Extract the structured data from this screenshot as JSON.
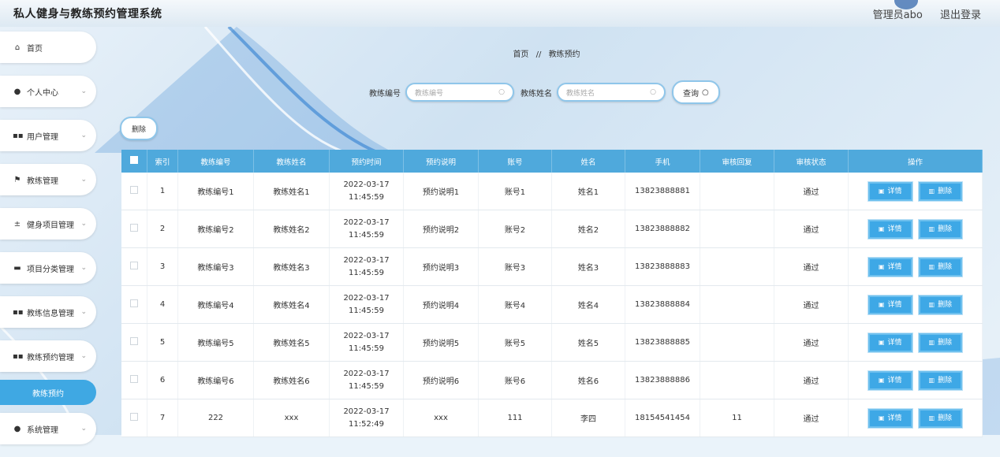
{
  "app": {
    "title": "私人健身与教练预约管理系统"
  },
  "header": {
    "user": "管理员abo",
    "logout": "退出登录"
  },
  "sidebar": {
    "items": [
      {
        "label": "首页",
        "icon": "home-icon"
      },
      {
        "label": "个人中心",
        "icon": "user-icon"
      },
      {
        "label": "用户管理",
        "icon": "grid-icon"
      },
      {
        "label": "教练管理",
        "icon": "flag-icon"
      },
      {
        "label": "健身项目管理",
        "icon": "dumbbell-icon"
      },
      {
        "label": "项目分类管理",
        "icon": "bookmark-icon"
      },
      {
        "label": "教练信息管理",
        "icon": "grid-icon"
      },
      {
        "label": "教练预约管理",
        "icon": "grid-icon"
      },
      {
        "label": "系统管理",
        "icon": "user-icon"
      }
    ],
    "active_sub": "教练预约"
  },
  "breadcrumb": {
    "home": "首页",
    "sep": "//",
    "current": "教练预约"
  },
  "search": {
    "field1_label": "教练编号",
    "field1_placeholder": "教练编号",
    "field2_label": "教练姓名",
    "field2_placeholder": "教练姓名",
    "query_label": "查询"
  },
  "actions": {
    "delete_label": "删除"
  },
  "table": {
    "headers": [
      "索引",
      "教练编号",
      "教练姓名",
      "预约时间",
      "预约说明",
      "账号",
      "姓名",
      "手机",
      "审核回复",
      "审核状态",
      "操作"
    ],
    "rows": [
      {
        "idx": "1",
        "coach_no": "教练编号1",
        "coach_name": "教练姓名1",
        "time": "2022-03-17 11:45:59",
        "note": "预约说明1",
        "account": "账号1",
        "name": "姓名1",
        "phone": "13823888881",
        "reply": "",
        "status": "通过"
      },
      {
        "idx": "2",
        "coach_no": "教练编号2",
        "coach_name": "教练姓名2",
        "time": "2022-03-17 11:45:59",
        "note": "预约说明2",
        "account": "账号2",
        "name": "姓名2",
        "phone": "13823888882",
        "reply": "",
        "status": "通过"
      },
      {
        "idx": "3",
        "coach_no": "教练编号3",
        "coach_name": "教练姓名3",
        "time": "2022-03-17 11:45:59",
        "note": "预约说明3",
        "account": "账号3",
        "name": "姓名3",
        "phone": "13823888883",
        "reply": "",
        "status": "通过"
      },
      {
        "idx": "4",
        "coach_no": "教练编号4",
        "coach_name": "教练姓名4",
        "time": "2022-03-17 11:45:59",
        "note": "预约说明4",
        "account": "账号4",
        "name": "姓名4",
        "phone": "13823888884",
        "reply": "",
        "status": "通过"
      },
      {
        "idx": "5",
        "coach_no": "教练编号5",
        "coach_name": "教练姓名5",
        "time": "2022-03-17 11:45:59",
        "note": "预约说明5",
        "account": "账号5",
        "name": "姓名5",
        "phone": "13823888885",
        "reply": "",
        "status": "通过"
      },
      {
        "idx": "6",
        "coach_no": "教练编号6",
        "coach_name": "教练姓名6",
        "time": "2022-03-17 11:45:59",
        "note": "预约说明6",
        "account": "账号6",
        "name": "姓名6",
        "phone": "13823888886",
        "reply": "",
        "status": "通过"
      },
      {
        "idx": "7",
        "coach_no": "222",
        "coach_name": "xxx",
        "time": "2022-03-17 11:52:49",
        "note": "xxx",
        "account": "111",
        "name": "李四",
        "phone": "18154541454",
        "reply": "11",
        "status": "通过"
      }
    ],
    "detail_label": "详情",
    "delete_label": "删除"
  },
  "colors": {
    "accent": "#3ea8e6",
    "header": "#4fa9dc"
  }
}
